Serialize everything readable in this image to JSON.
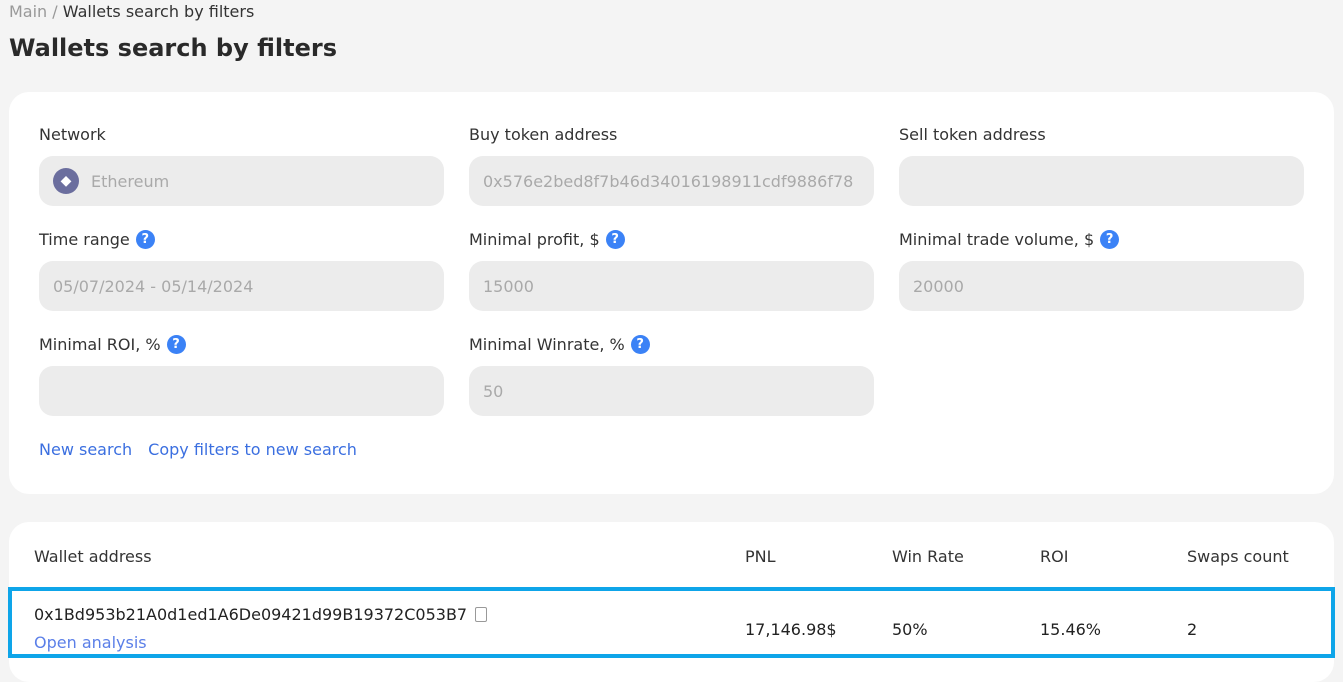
{
  "breadcrumb": {
    "root": "Main",
    "sep": "/",
    "current": "Wallets search by filters"
  },
  "title": "Wallets search by filters",
  "filters": [
    {
      "label": "Network",
      "value": "Ethereum",
      "icon": "ethereum-icon",
      "help": false
    },
    {
      "label": "Buy token address",
      "value": "0x576e2bed8f7b46d34016198911cdf9886f78",
      "help": false
    },
    {
      "label": "Sell token address",
      "value": "",
      "help": false
    },
    {
      "label": "Time range",
      "value": "05/07/2024 - 05/14/2024",
      "help": true
    },
    {
      "label": "Minimal profit, $",
      "value": "15000",
      "help": true
    },
    {
      "label": "Minimal trade volume, $",
      "value": "20000",
      "help": true
    },
    {
      "label": "Minimal ROI, %",
      "value": "",
      "help": true
    },
    {
      "label": "Minimal Winrate, %",
      "value": "50",
      "help": true
    }
  ],
  "help_glyph": "?",
  "actions": {
    "new_search": "New search",
    "copy_filters": "Copy filters to new search"
  },
  "table": {
    "headers": [
      "Wallet address",
      "PNL",
      "Win Rate",
      "ROI",
      "Swaps count"
    ],
    "rows": [
      {
        "address": "0x1Bd953b21A0d1ed1A6De09421d99B19372C053B7",
        "link": "Open analysis",
        "pnl": "17,146.98$",
        "winrate": "50%",
        "roi": "15.46%",
        "swaps": "2"
      }
    ]
  },
  "colors": {
    "accent": "#3b82f6",
    "highlight": "#0ea5e9"
  }
}
